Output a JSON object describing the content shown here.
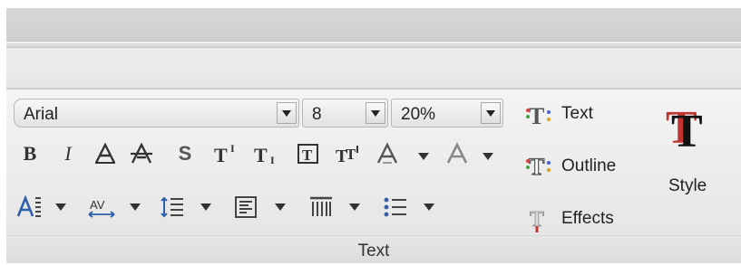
{
  "font_box": {
    "name": "Arial",
    "size": "8",
    "percent": "20%"
  },
  "text_group": {
    "label": "Text"
  },
  "wordart_buttons": {
    "text": "Text",
    "outline": "Outline",
    "effects": "Effects",
    "style": "Style"
  },
  "icons": [
    "bold-icon",
    "italic-icon",
    "outline-a-icon",
    "strikethrough-a-icon",
    "shadow-s-icon",
    "superscript-icon",
    "subscript-icon",
    "boxed-t-icon",
    "double-t-icon",
    "text-effects-icon",
    "font-color-icon",
    "char-format-icon",
    "char-spacing-icon",
    "line-spacing-icon",
    "align-icon",
    "columns-icon",
    "bullets-icon",
    "wordart-text-icon",
    "wordart-outline-icon",
    "wordart-effects-icon",
    "wordart-style-icon"
  ],
  "colors": {
    "accent_blue": "#2f5fa8",
    "accent_red": "#c0352f"
  }
}
